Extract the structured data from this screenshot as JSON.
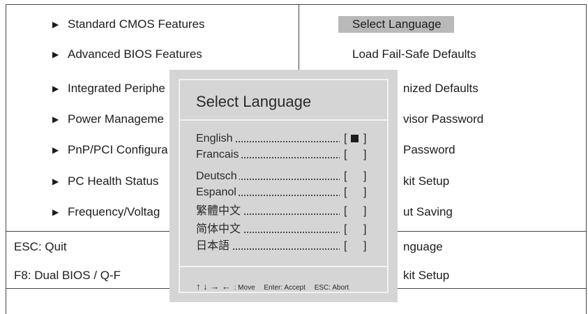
{
  "left_menu": [
    {
      "label": "Standard CMOS Features"
    },
    {
      "label": "Advanced BIOS Features"
    },
    {
      "label": "Integrated Periphe"
    },
    {
      "label": "Power Manageme"
    },
    {
      "label": "PnP/PCI Configura"
    },
    {
      "label": "PC Health Status"
    },
    {
      "label": "Frequency/Voltag"
    }
  ],
  "right_menu": [
    {
      "label": "Select Language",
      "selected": true
    },
    {
      "label": "Load Fail-Safe Defaults"
    },
    {
      "label": "nized Defaults"
    },
    {
      "label": "visor Password"
    },
    {
      "label": "Password"
    },
    {
      "label": "kit Setup"
    },
    {
      "label": "ut Saving"
    }
  ],
  "status": {
    "left": [
      "ESC: Quit",
      "F8: Dual BIOS / Q-F"
    ],
    "right": [
      "nguage",
      "kit Setup"
    ]
  },
  "dialog": {
    "title": "Select Language",
    "languages": [
      {
        "name": "English",
        "box_open": "[",
        "box_close": "]",
        "selected": true
      },
      {
        "name": "Francais",
        "box_open": "[",
        "box_close": "]",
        "selected": false
      },
      {
        "name": "Deutsch",
        "box_open": "[",
        "box_close": "]",
        "selected": false
      },
      {
        "name": "Espanol",
        "box_open": "[",
        "box_close": "]",
        "selected": false
      },
      {
        "name": "繁體中文",
        "box_open": "[",
        "box_close": "]",
        "selected": false
      },
      {
        "name": "简体中文",
        "box_open": "[",
        "box_close": "]",
        "selected": false
      },
      {
        "name": "日本語",
        "box_open": "[",
        "box_close": "]",
        "selected": false
      }
    ],
    "help": {
      "arrows": "↑ ↓ → ←",
      "move": ": Move",
      "accept": "Enter: Accept",
      "abort": "ESC: Abort"
    }
  },
  "icons": {
    "menu_arrow": "triangle-right-icon",
    "nav_arrows": "navigation-arrows-icon"
  },
  "colors": {
    "selection_bg": "#b9b9b9",
    "dialog_bg": "#d5d5d5",
    "dialog_border": "#f2f2f2",
    "text": "#1c1c1c"
  }
}
